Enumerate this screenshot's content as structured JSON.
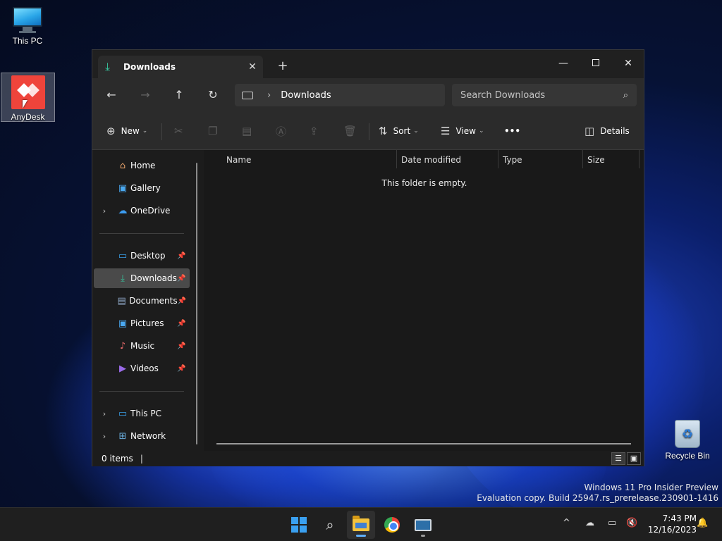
{
  "desktop": {
    "icons": [
      {
        "label": "This PC"
      },
      {
        "label": "AnyDesk"
      },
      {
        "label": "Recycle Bin"
      }
    ],
    "watermark": {
      "line1": "Windows 11 Pro Insider Preview",
      "line2": "Evaluation copy. Build 25947.rs_prerelease.230901-1416"
    }
  },
  "window": {
    "tab": {
      "title": "Downloads",
      "close": "✕",
      "icon": "download-icon"
    },
    "new_tab": "+",
    "controls": {
      "minimize": "—",
      "close": "✕"
    },
    "nav": {
      "back": "←",
      "forward": "→",
      "up": "↑",
      "refresh": "↻"
    },
    "address": {
      "chevron": "›",
      "crumb": "Downloads"
    },
    "search": {
      "placeholder": "Search Downloads",
      "icon": "⌕"
    },
    "commands": {
      "new": "New",
      "sort": "Sort",
      "view": "View",
      "more": "•••",
      "details": "Details"
    },
    "sidebar": {
      "items": [
        {
          "label": "Home",
          "icon": "home-icon"
        },
        {
          "label": "Gallery",
          "icon": "gallery-icon"
        },
        {
          "label": "OneDrive",
          "icon": "cloud-icon"
        },
        {
          "label": "Desktop",
          "icon": "desktop-icon"
        },
        {
          "label": "Downloads",
          "icon": "download-icon"
        },
        {
          "label": "Documents",
          "icon": "documents-icon"
        },
        {
          "label": "Pictures",
          "icon": "pictures-icon"
        },
        {
          "label": "Music",
          "icon": "music-icon"
        },
        {
          "label": "Videos",
          "icon": "videos-icon"
        },
        {
          "label": "This PC",
          "icon": "pc-icon"
        },
        {
          "label": "Network",
          "icon": "network-icon"
        }
      ],
      "selected": "Downloads"
    },
    "columns": [
      "Name",
      "Date modified",
      "Type",
      "Size"
    ],
    "empty_message": "This folder is empty.",
    "status": {
      "items": "0 items",
      "caret": "|"
    }
  },
  "taskbar": {
    "clock": {
      "time": "7:43 PM",
      "date": "12/16/2023"
    },
    "tray": {
      "chevron": "^"
    }
  },
  "colors": {
    "accent": "#60b0ff",
    "download_green": "#37c8a0",
    "window_bg": "#191919",
    "toolbar_bg": "#2b2b2b",
    "selected_bg": "#4a4a4a"
  }
}
